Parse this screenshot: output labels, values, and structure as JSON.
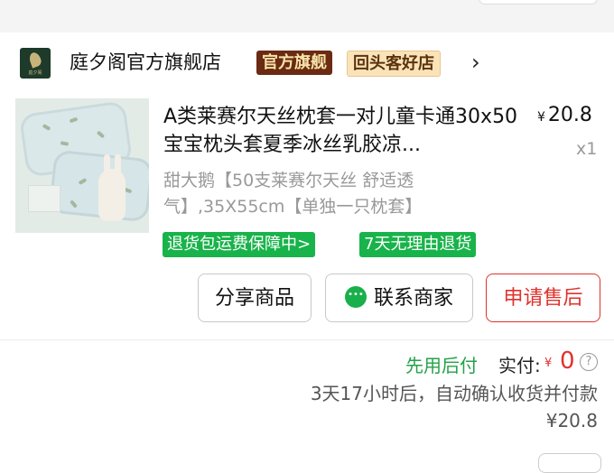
{
  "shop": {
    "name": "庭夕阁官方旗舰店",
    "logo_text": "庭夕阁",
    "badge_official": "官方旗舰",
    "badge_repeat": "回头客好店",
    "chevron": "›"
  },
  "item": {
    "title": "A类莱赛尔天丝枕套一对儿童卡通30x50宝宝枕头套夏季冰丝乳胶凉...",
    "price_symbol": "¥",
    "price": "20.8",
    "quantity": "x1",
    "spec": "甜大鹅【50支莱赛尔天丝 舒适透气】,35X55cm【单独一只枕套】",
    "tags": [
      "退货包运费保障中>",
      "7天无理由退货"
    ]
  },
  "actions": {
    "share": "分享商品",
    "contact": "联系商家",
    "after_sale": "申请售后"
  },
  "payment": {
    "pay_later": "先用后付",
    "paid_label": "实付:",
    "paid_symbol": "¥",
    "paid_value": "0",
    "help": "?",
    "auto_confirm": "3天17小时后，自动确认收货并付款¥20.8"
  },
  "colors": {
    "accent_red": "#e0322b",
    "accent_green": "#18b34a",
    "badge_official_bg": "#6b2a12"
  }
}
